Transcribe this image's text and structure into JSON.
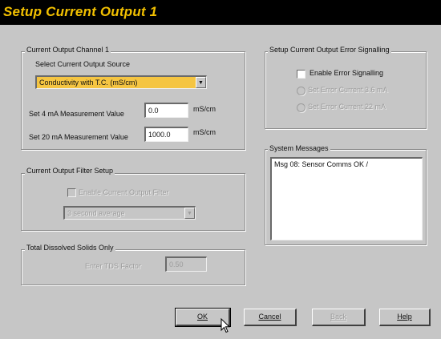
{
  "window": {
    "title": "Setup Current Output 1",
    "title_color": "#f2c000",
    "titlebar_color": "#000000",
    "face_color": "#c6c6c6",
    "combo_highlight": "#f5c542"
  },
  "channel": {
    "group_label": "Current Output Channel 1",
    "source_label": "Select Current Output Source",
    "source_value": "Conductivity with T.C. (mS/cm)",
    "set4_label": "Set 4 mA Measurement Value",
    "set4_value": "0.0",
    "set4_unit": "mS/cm",
    "set20_label": "Set 20 mA Measurement Value",
    "set20_value": "1000.0",
    "set20_unit": "mS/cm"
  },
  "filter": {
    "group_label": "Current Output Filter Setup",
    "enable_label": "Enable Current Output Filter",
    "enabled": false,
    "filter_type_value": "3 second average"
  },
  "tds": {
    "group_label": "Total Dissolved Solids Only",
    "factor_label": "Enter TDS Factor",
    "factor_value": "0.50"
  },
  "error_signal": {
    "group_label": "Setup Current Output Error Signalling",
    "enable_label": "Enable Error Signalling",
    "enabled": false,
    "option1_label": "Set Error Current 3.6 mA",
    "option2_label": "Set Error Current 22 mA"
  },
  "messages": {
    "group_label": "System Messages",
    "text": "Msg 08: Sensor Comms OK  /"
  },
  "buttons": {
    "ok": "OK",
    "cancel": "Cancel",
    "back": "Back",
    "help": "Help"
  }
}
